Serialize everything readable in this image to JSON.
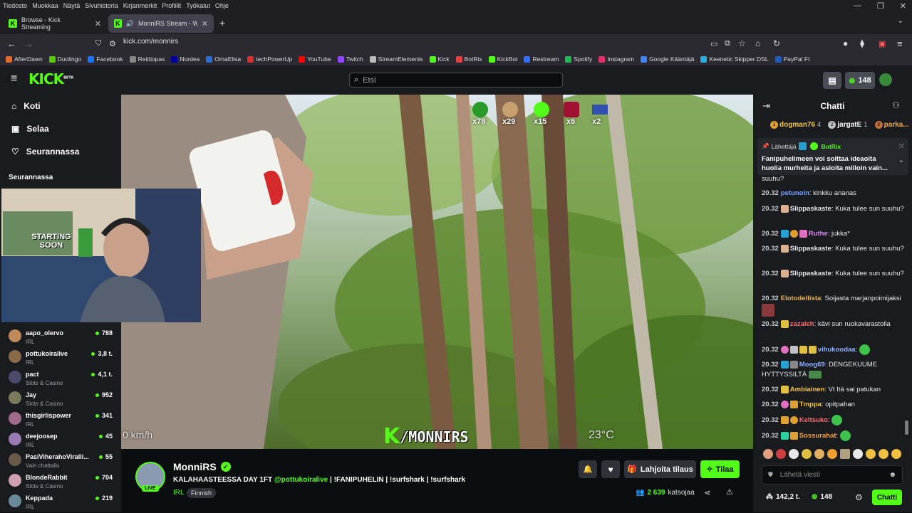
{
  "browser": {
    "menu": [
      "Tiedosto",
      "Muokkaa",
      "Näytä",
      "Sivuhistoria",
      "Kirjanmerkit",
      "Profiilit",
      "Työkalut",
      "Ohje"
    ],
    "tabs": [
      {
        "title": "Browse - Kick Streaming",
        "active": false
      },
      {
        "title": "MonniRS Stream - Watch L",
        "active": true
      }
    ],
    "url": "kick.com/monnirs",
    "bookmarks": [
      {
        "label": "AfterDawn",
        "color": "#e06b2d"
      },
      {
        "label": "Duolingo",
        "color": "#58cc02"
      },
      {
        "label": "Facebook",
        "color": "#1877f2"
      },
      {
        "label": "Reittiopas",
        "color": "#888888"
      },
      {
        "label": "Nordea",
        "color": "#0000a0"
      },
      {
        "label": "OmaElisa",
        "color": "#2b6fd6"
      },
      {
        "label": "techPowerUp",
        "color": "#d63030"
      },
      {
        "label": "YouTube",
        "color": "#ff0000"
      },
      {
        "label": "Twitch",
        "color": "#9146ff"
      },
      {
        "label": "StreamElements",
        "color": "#bbbbbb"
      },
      {
        "label": "Kick",
        "color": "#53fc18"
      },
      {
        "label": "BotRix",
        "color": "#e04040"
      },
      {
        "label": "KickBot",
        "color": "#53fc18"
      },
      {
        "label": "Restream",
        "color": "#2f6fff"
      },
      {
        "label": "Spotify",
        "color": "#1db954"
      },
      {
        "label": "Instagram",
        "color": "#e1306c"
      },
      {
        "label": "Google Kääntäjä",
        "color": "#4285f4"
      },
      {
        "label": "Keenetic Skipper DSL",
        "color": "#2ab0e0"
      },
      {
        "label": "PayPal FI",
        "color": "#1f5bb5"
      }
    ]
  },
  "kick": {
    "logo": "KICK",
    "logo_beta": "BETA",
    "search_placeholder": "Etsi",
    "header_points": "148",
    "accent": "#53fc18"
  },
  "sidebar": {
    "nav": [
      {
        "label": "Koti",
        "icon": "home-icon"
      },
      {
        "label": "Selaa",
        "icon": "browse-icon"
      },
      {
        "label": "Seurannassa",
        "icon": "heart-icon"
      }
    ],
    "section_title": "Seurannassa",
    "channels": [
      {
        "name": "aapo_olervo",
        "category": "IRL",
        "viewers": "788",
        "color": "#c08a5a"
      },
      {
        "name": "pottukoiralive",
        "category": "IRL",
        "viewers": "3,8 t.",
        "color": "#8a6a4a"
      },
      {
        "name": "pact",
        "category": "Slots & Casino",
        "viewers": "4,1 t.",
        "color": "#4a4a6a"
      },
      {
        "name": "Jay",
        "category": "Slots & Casino",
        "viewers": "952",
        "color": "#7a7a5a"
      },
      {
        "name": "thisgirlispower",
        "category": "IRL",
        "viewers": "341",
        "color": "#a06a8a"
      },
      {
        "name": "deejoosep",
        "category": "IRL",
        "viewers": "45",
        "color": "#9a7ab0"
      },
      {
        "name": "PasiViherahoViralli...",
        "category": "Vain chattailu",
        "viewers": "55",
        "color": "#6a5a4a"
      },
      {
        "name": "BlondeRabbit",
        "category": "Slots & Casino",
        "viewers": "704",
        "color": "#d0a0b0"
      },
      {
        "name": "Keppada",
        "category": "IRL",
        "viewers": "219",
        "color": "#6a8a9a"
      }
    ]
  },
  "webcam": {
    "poster_text": "STARTING SOON"
  },
  "video": {
    "speed": "0 km/h",
    "temperature": "23°C",
    "watermark": "/MONNIRS",
    "emote_counts": [
      "x78",
      "x29",
      "x15",
      "x6",
      "x2"
    ]
  },
  "stream": {
    "streamer": "MonniRS",
    "live_badge": "LIVE",
    "title_pre": "KALAHAASTEESSA DAY 1FT",
    "title_mention": "@pottukoiralive",
    "title_post": "| !FANIPUHELIN | !surfshark | !surfshark",
    "category": "IRL",
    "tag": "Finnish",
    "viewers": "2 639",
    "viewers_label": "katsojaa",
    "gift_label": "Lahjoita tilaus",
    "subscribe_label": "Tilaa"
  },
  "chat": {
    "title": "Chatti",
    "top_gifters": [
      {
        "rank": "1",
        "name": "dogman76",
        "count": "4"
      },
      {
        "rank": "2",
        "name": "jargatE",
        "count": "1"
      },
      {
        "rank": "3",
        "name": "parka...",
        "count": ""
      }
    ],
    "pinned": {
      "label": "Lähettäjä",
      "sender": "BotRix",
      "text": "Fanipuhelimeen voi soittaa ideaoita huolia murheita ja asioita milloin vain..."
    },
    "messages": [
      {
        "time": "",
        "user": "",
        "color": "#e8eaed",
        "text": "suuhu?"
      },
      {
        "time": "20.32",
        "user": "petunoin",
        "color": "#7aa2ff",
        "text": "kinkku ananas"
      },
      {
        "time": "20.32",
        "user": "Slippaskaste",
        "color": "#e8eaed",
        "text": "Kuka tulee sun suuhu?"
      },
      {
        "time": "20.32",
        "user": "Ruthe",
        "color": "#d98cf0",
        "text": "jukka*"
      },
      {
        "time": "20.32",
        "user": "Slippaskaste",
        "color": "#e8eaed",
        "text": "Kuka tulee sun suuhu?"
      },
      {
        "time": "20.32",
        "user": "Slippaskaste",
        "color": "#e8eaed",
        "text": "Kuka tulee sun suuhu?"
      },
      {
        "time": "20.32",
        "user": "Elotodellista",
        "color": "#e8b64c",
        "text": "Soijasta marjanpoimijaksi"
      },
      {
        "time": "20.32",
        "user": "zazaleh",
        "color": "#ff6b6b",
        "text": "kävi sun ruokavarastolla"
      },
      {
        "time": "20.32",
        "user": "vihukoodaa",
        "color": "#8fb0ff",
        "text": ""
      },
      {
        "time": "20.32",
        "user": "Moog69",
        "color": "#8fb0ff",
        "text": "DENGEKUUME HYTTYSSILTÄ"
      },
      {
        "time": "20.32",
        "user": "Ambiainen",
        "color": "#f5c542",
        "text": "Vt Itä sai patukan"
      },
      {
        "time": "20.32",
        "user": "Tmppa",
        "color": "#f5c542",
        "text": "opitpahan"
      },
      {
        "time": "20.32",
        "user": "Keltsuko",
        "color": "#ff6b6b",
        "text": ""
      },
      {
        "time": "20.32",
        "user": "Sossurahat",
        "color": "#f5a742",
        "text": ""
      }
    ],
    "input_placeholder": "Lähetä viesti",
    "footer_points": "142,2 t.",
    "footer_kick": "148",
    "send_label": "Chatti"
  }
}
